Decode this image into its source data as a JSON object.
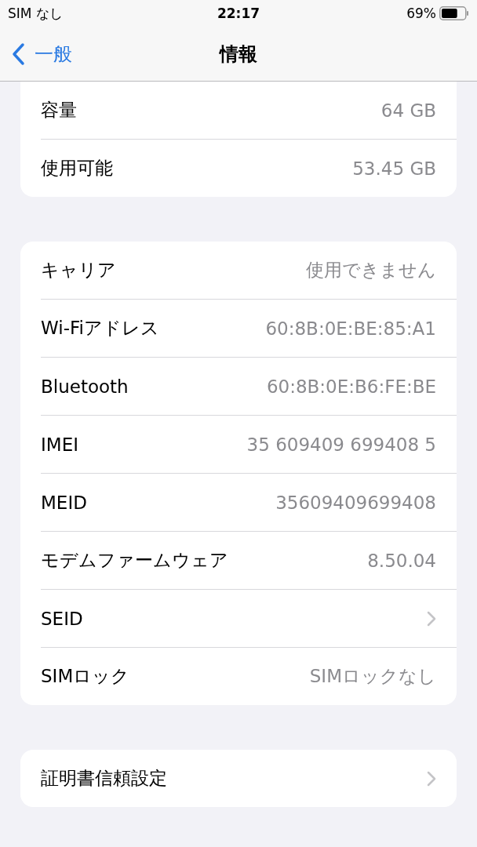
{
  "status_bar": {
    "carrier": "SIM なし",
    "time": "22:17",
    "battery": "69%"
  },
  "nav": {
    "back": "一般",
    "title": "情報"
  },
  "groups": [
    {
      "rows": [
        {
          "kind": "value",
          "label": "容量",
          "value": "64 GB"
        },
        {
          "kind": "value",
          "label": "使用可能",
          "value": "53.45 GB"
        }
      ]
    },
    {
      "rows": [
        {
          "kind": "value",
          "label": "キャリア",
          "value": "使用できません"
        },
        {
          "kind": "value",
          "label": "Wi-Fiアドレス",
          "value": "60:8B:0E:BE:85:A1"
        },
        {
          "kind": "value",
          "label": "Bluetooth",
          "value": "60:8B:0E:B6:FE:BE"
        },
        {
          "kind": "value",
          "label": "IMEI",
          "value": "35 609409 699408 5"
        },
        {
          "kind": "value",
          "label": "MEID",
          "value": "35609409699408"
        },
        {
          "kind": "value",
          "label": "モデムファームウェア",
          "value": "8.50.04"
        },
        {
          "kind": "link",
          "label": "SEID"
        },
        {
          "kind": "value",
          "label": "SIMロック",
          "value": "SIMロックなし"
        }
      ]
    },
    {
      "rows": [
        {
          "kind": "link",
          "label": "証明書信頼設定"
        }
      ]
    }
  ]
}
